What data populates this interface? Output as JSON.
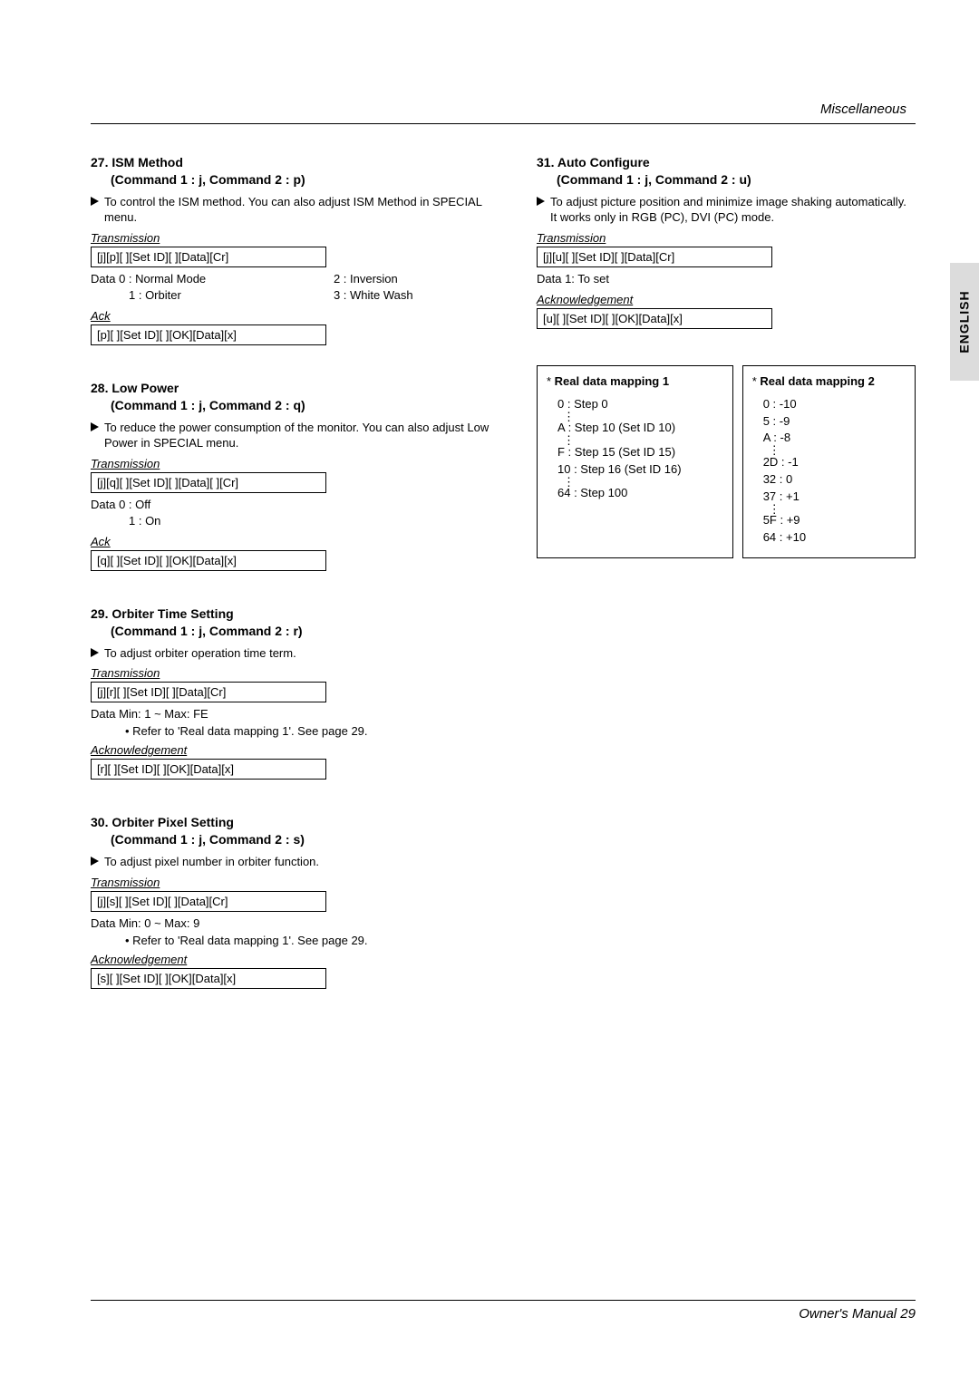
{
  "header": {
    "category": "Miscellaneous"
  },
  "sideTab": "ENGLISH",
  "footer": {
    "text": "Owner's Manual   29"
  },
  "s27": {
    "title": "27. ISM Method",
    "sub": "(Command 1 : j, Command 2 : p)",
    "desc": "To control the ISM method. You can also adjust ISM Method in SPECIAL menu.",
    "transLabel": "Transmission",
    "trans": "[j][p][  ][Set ID][  ][Data][Cr]",
    "d0": "Data   0  : Normal Mode",
    "d1": "1  : Orbiter",
    "d2": "2  : Inversion",
    "d3": "3  : White Wash",
    "ackLabel": "Ack",
    "ack": "[p][  ][Set ID][  ][OK][Data][x]"
  },
  "s28": {
    "title": "28. Low Power",
    "sub": "(Command 1 : j, Command 2 : q)",
    "desc": "To reduce the power consumption of the monitor. You can also adjust Low Power in SPECIAL menu.",
    "transLabel": "Transmission",
    "trans": "[j][q][  ][Set ID][  ][Data][  ][Cr]",
    "d0": "Data   0  : Off",
    "d1": "1  : On",
    "ackLabel": "Ack",
    "ack": "[q][  ][Set ID][  ][OK][Data][x]"
  },
  "s29": {
    "title": "29. Orbiter Time Setting",
    "sub": "(Command 1 : j, Command 2 : r)",
    "desc": "To adjust orbiter operation time term.",
    "transLabel": "Transmission",
    "trans": "[j][r][  ][Set ID][  ][Data][Cr]",
    "d0": "Data   Min: 1 ~ Max: FE",
    "note": "• Refer to 'Real data mapping 1'. See page 29.",
    "ackLabel": "Acknowledgement",
    "ack": "[r][  ][Set ID][  ][OK][Data][x]"
  },
  "s30": {
    "title": "30. Orbiter Pixel Setting",
    "sub": "(Command 1 : j, Command 2 : s)",
    "desc": "To adjust pixel number in orbiter function.",
    "transLabel": "Transmission",
    "trans": "[j][s][  ][Set ID][  ][Data][Cr]",
    "d0": "Data   Min: 0 ~ Max: 9",
    "note": "• Refer to 'Real data mapping 1'. See page 29.",
    "ackLabel": "Acknowledgement",
    "ack": "[s][  ][Set ID][  ][OK][Data][x]"
  },
  "s31": {
    "title": "31. Auto Configure",
    "sub": "(Command 1 : j, Command 2 : u)",
    "desc": "To adjust picture position and minimize image shaking automatically. It works only in RGB (PC), DVI (PC) mode.",
    "transLabel": "Transmission",
    "trans": "[j][u][  ][Set ID][  ][Data][Cr]",
    "d0": "Data   1: To set",
    "ackLabel": "Acknowledgement",
    "ack": "[u][  ][Set ID][  ][OK][Data][x]"
  },
  "map1": {
    "title": "Real data mapping 1",
    "l0": "0  : Step 0",
    "lA": "A  : Step 10 (Set ID 10)",
    "lF": "F  : Step 15 (Set ID 15)",
    "l10": "10 : Step 16 (Set ID 16)",
    "l64": "64 : Step 100"
  },
  "map2": {
    "title": "Real data mapping 2",
    "l0": "0   :  -10",
    "l5": "5   :  -9",
    "lA": "A   :  -8",
    "l2D": "2D :  -1",
    "l32": "32 :  0",
    "l37": "37 :  +1",
    "l5F": "5F :  +9",
    "l64": "64 :  +10"
  }
}
